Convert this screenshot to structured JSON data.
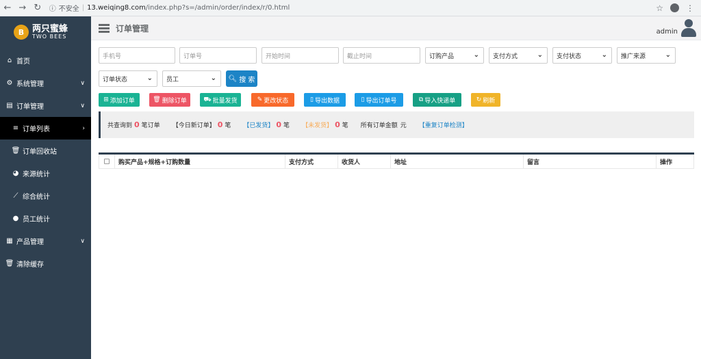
{
  "browser": {
    "insecure_label": "不安全",
    "url_host": "13.weiqing8.com",
    "url_path": "/index.php?s=/admin/order/index/r/0.html"
  },
  "logo": {
    "cn": "两只蜜蜂",
    "en": "TWO BEES",
    "badge": "B"
  },
  "sidebar": {
    "items": [
      {
        "label": "首页",
        "icon": "home-icon"
      },
      {
        "label": "系统管理",
        "icon": "gear-icon"
      },
      {
        "label": "订单管理",
        "icon": "list-icon"
      },
      {
        "label": "订单列表",
        "icon": "bars-icon"
      },
      {
        "label": "订单回收站",
        "icon": "trash-icon"
      },
      {
        "label": "来源统计",
        "icon": "pie-chart-icon"
      },
      {
        "label": "综合统计",
        "icon": "line-chart-icon"
      },
      {
        "label": "员工统计",
        "icon": "user-icon"
      },
      {
        "label": "产品管理",
        "icon": "grid-icon"
      },
      {
        "label": "清除缓存",
        "icon": "trash-icon"
      }
    ]
  },
  "header": {
    "title": "订单管理",
    "username": "admin"
  },
  "filters": {
    "phone_placeholder": "手机号",
    "order_no_placeholder": "订单号",
    "start_time_placeholder": "开始时间",
    "end_time_placeholder": "截止时间",
    "product": "订购产品",
    "pay_method": "支付方式",
    "pay_status": "支付状态",
    "source": "推广来源",
    "order_status": "订单状态",
    "staff": "员工",
    "search": "搜 索"
  },
  "actions": {
    "add": "添加订单",
    "delete": "删除订单",
    "ship": "批量发货",
    "change_status": "更改状态",
    "export_data": "导出数据",
    "export_order_no": "导出订单号",
    "import_express": "导入快递单",
    "refresh": "刷新"
  },
  "stats": {
    "total_prefix": "共查询到",
    "total_count": "0",
    "total_suffix": "笔订单",
    "today_label": "【今日新订单】",
    "today_count": "0",
    "unit": "笔",
    "shipped_label": "【已发货】",
    "shipped_count": "0",
    "unshipped_label": "【未发货】",
    "unshipped_count": "0",
    "amount_label": "所有订单金额",
    "amount_unit": "元",
    "dup_check": "【重复订单检测】"
  },
  "table": {
    "columns": [
      "购买产品+规格+订购数量",
      "支付方式",
      "收货人",
      "地址",
      "留言",
      "操作"
    ]
  },
  "colors": {
    "sidebar": "#2f4050",
    "primary": "#1c84c6",
    "success": "#1ab394",
    "danger": "#ed5565",
    "warning": "#f8ac59",
    "info": "#23c6c8"
  }
}
